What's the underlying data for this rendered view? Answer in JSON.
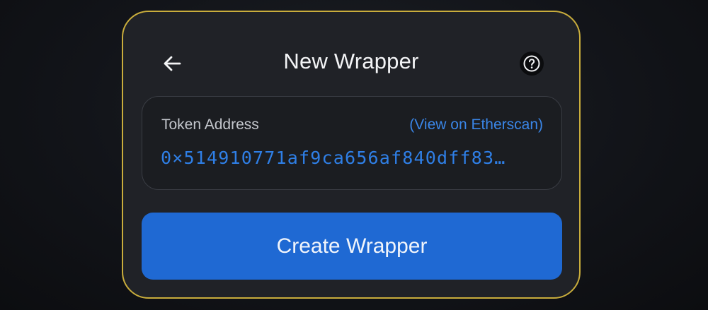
{
  "header": {
    "back_icon": "arrow-left-icon",
    "title": "New Wrapper",
    "help_icon": "question-circle-icon"
  },
  "token": {
    "label": "Token Address",
    "link_text": "(View on Etherscan)",
    "address": "0×514910771af9ca656af840dff83…"
  },
  "actions": {
    "create_label": "Create Wrapper"
  },
  "colors": {
    "accent_border": "#c9ad3c",
    "primary_button": "#1f69d3",
    "link": "#3a86e8"
  }
}
